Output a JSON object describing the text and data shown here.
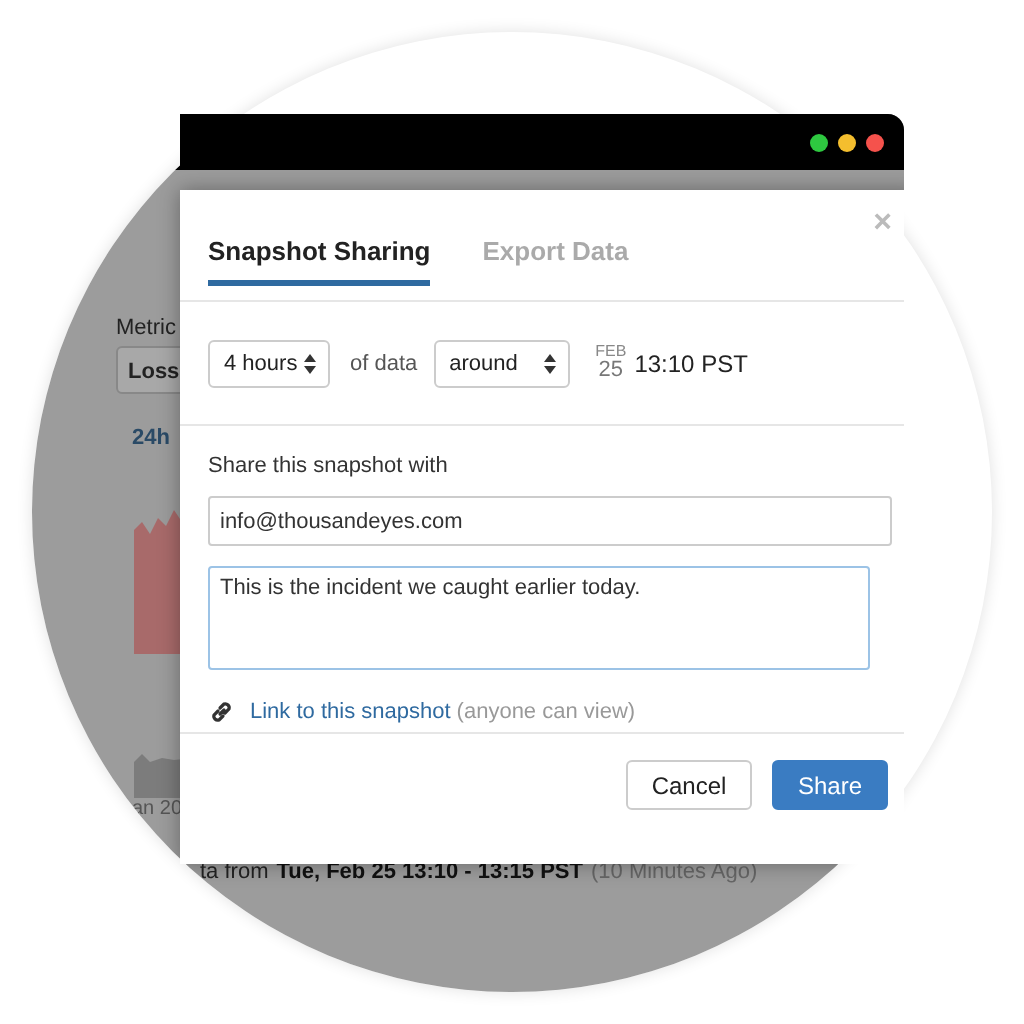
{
  "window": {
    "controls": [
      {
        "color": "#2ec840"
      },
      {
        "color": "#f4be2e"
      },
      {
        "color": "#f5524c"
      }
    ]
  },
  "background": {
    "metric_label": "Metric",
    "metric_select": "Loss",
    "range_tab": "24h",
    "axis_label": "an 20",
    "status_prefix": "ta from",
    "status_range": "Tue, Feb 25 13:10 - 13:15 PST",
    "status_age": "(10 Minutes Ago)"
  },
  "dialog": {
    "tabs": [
      {
        "label": "Snapshot Sharing",
        "selected": true
      },
      {
        "label": "Export Data",
        "selected": false
      }
    ],
    "close": "×",
    "duration": "4 hours",
    "duration_suffix": "of data",
    "anchor": "around",
    "month": "FEB",
    "day": "25",
    "time": "13:10 PST",
    "share_label": "Share this snapshot with",
    "recipients": "info@thousandeyes.com",
    "message": "This is the incident we caught earlier today.",
    "link": "Link to this snapshot",
    "link_note": "(anyone can view)",
    "buttons": [
      {
        "label": "Cancel",
        "kind": "secondary"
      },
      {
        "label": "Share",
        "kind": "primary"
      }
    ]
  }
}
